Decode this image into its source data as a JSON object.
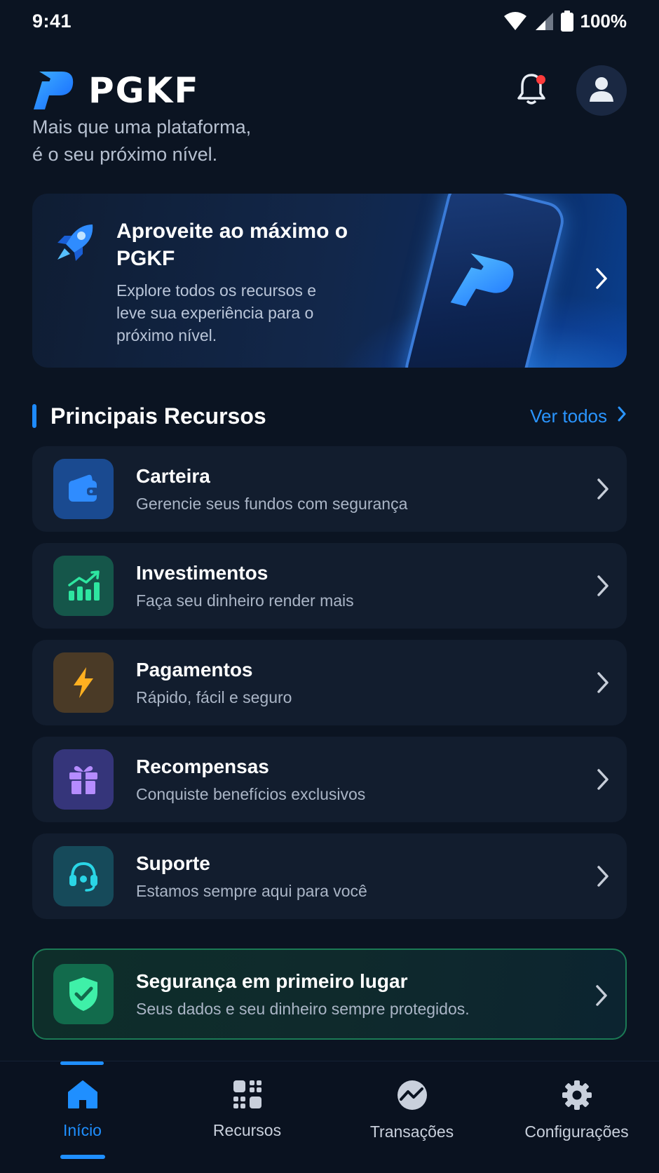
{
  "status": {
    "time": "9:41",
    "battery": "100%"
  },
  "header": {
    "brand": "PGKF",
    "tagline_line1": "Mais que uma plataforma,",
    "tagline_line2": "é o seu próximo nível.",
    "notification_dot_color": "#ff3b3b"
  },
  "hero": {
    "title": "Aproveite ao máximo o PGKF",
    "text": "Explore todos os recursos e leve sua experiência para o próximo nível."
  },
  "section": {
    "title": "Principais Recursos",
    "see_all": "Ver todos"
  },
  "features": [
    {
      "title": "Carteira",
      "subtitle": "Gerencie seus fundos com segurança",
      "icon": "wallet-icon",
      "color": "#2f8cff"
    },
    {
      "title": "Investimentos",
      "subtitle": "Faça seu dinheiro render mais",
      "icon": "chart-growth-icon",
      "color": "#2ee6a0"
    },
    {
      "title": "Pagamentos",
      "subtitle": "Rápido, fácil e seguro",
      "icon": "lightning-icon",
      "color": "#ffb020"
    },
    {
      "title": "Recompensas",
      "subtitle": "Conquiste benefícios exclusivos",
      "icon": "gift-icon",
      "color": "#b58cff"
    },
    {
      "title": "Suporte",
      "subtitle": "Estamos sempre aqui para você",
      "icon": "headset-icon",
      "color": "#2ad6e6"
    }
  ],
  "security": {
    "title": "Segurança em primeiro lugar",
    "subtitle": "Seus dados e seu dinheiro sempre protegidos.",
    "icon": "shield-check-icon",
    "color": "#3ff0a8"
  },
  "nav": [
    {
      "label": "Início",
      "icon": "home-icon",
      "active": true
    },
    {
      "label": "Recursos",
      "icon": "grid-icon",
      "active": false
    },
    {
      "label": "Transações",
      "icon": "transactions-icon",
      "active": false
    },
    {
      "label": "Configurações",
      "icon": "gear-icon",
      "active": false
    }
  ],
  "colors": {
    "accent": "#1f8fff",
    "background": "#0b1422",
    "card": "#121d2e"
  }
}
